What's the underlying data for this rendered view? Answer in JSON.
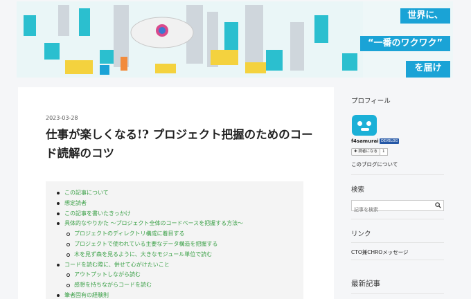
{
  "banner": {
    "caption_line1": "世界に、",
    "caption_line2": "“一番のワクワク”",
    "caption_line3": "を届ける"
  },
  "article": {
    "date": "2023-03-28",
    "title": "仕事が楽しくなる!? プロジェクト把握のためのコード読解のコツ",
    "toc": [
      {
        "label": "この記事について",
        "level": 1
      },
      {
        "label": "想定読者",
        "level": 1
      },
      {
        "label": "この記事を書いたきっかけ",
        "level": 1
      },
      {
        "label": "具体的なやりかた 〜プロジェクト全体のコードベースを把握する方法〜",
        "level": 1
      },
      {
        "label": "プロジェクトのディレクトリ構成に着目する",
        "level": 2
      },
      {
        "label": "プロジェクトで使われている主要なデータ構造を把握する",
        "level": 2
      },
      {
        "label": "木を見ず森を見るように、大きなモジュール単位で読む",
        "level": 2
      },
      {
        "label": "コードを読む際に、併せて心がけたいこと",
        "level": 1
      },
      {
        "label": "アウトプットしながら読む",
        "level": 2
      },
      {
        "label": "感想を持ちながらコードを読む",
        "level": 2
      },
      {
        "label": "筆者固有の経験則",
        "level": 1
      }
    ]
  },
  "sidebar": {
    "profile": {
      "heading": "プロフィール",
      "username": "f4samurai",
      "badge": "DEVBLOG",
      "reader_button": "読者になる",
      "reader_count": "1",
      "about_link": "このブログについて"
    },
    "search": {
      "heading": "検索",
      "placeholder": "記事を検索"
    },
    "links": {
      "heading": "リンク",
      "item": "CTO兼CHROメッセージ"
    },
    "recent": {
      "heading": "最新記事"
    }
  },
  "colors": {
    "accent_blue": "#1aa3d6",
    "toc_link": "#3ca148",
    "badge": "#2457a6"
  }
}
